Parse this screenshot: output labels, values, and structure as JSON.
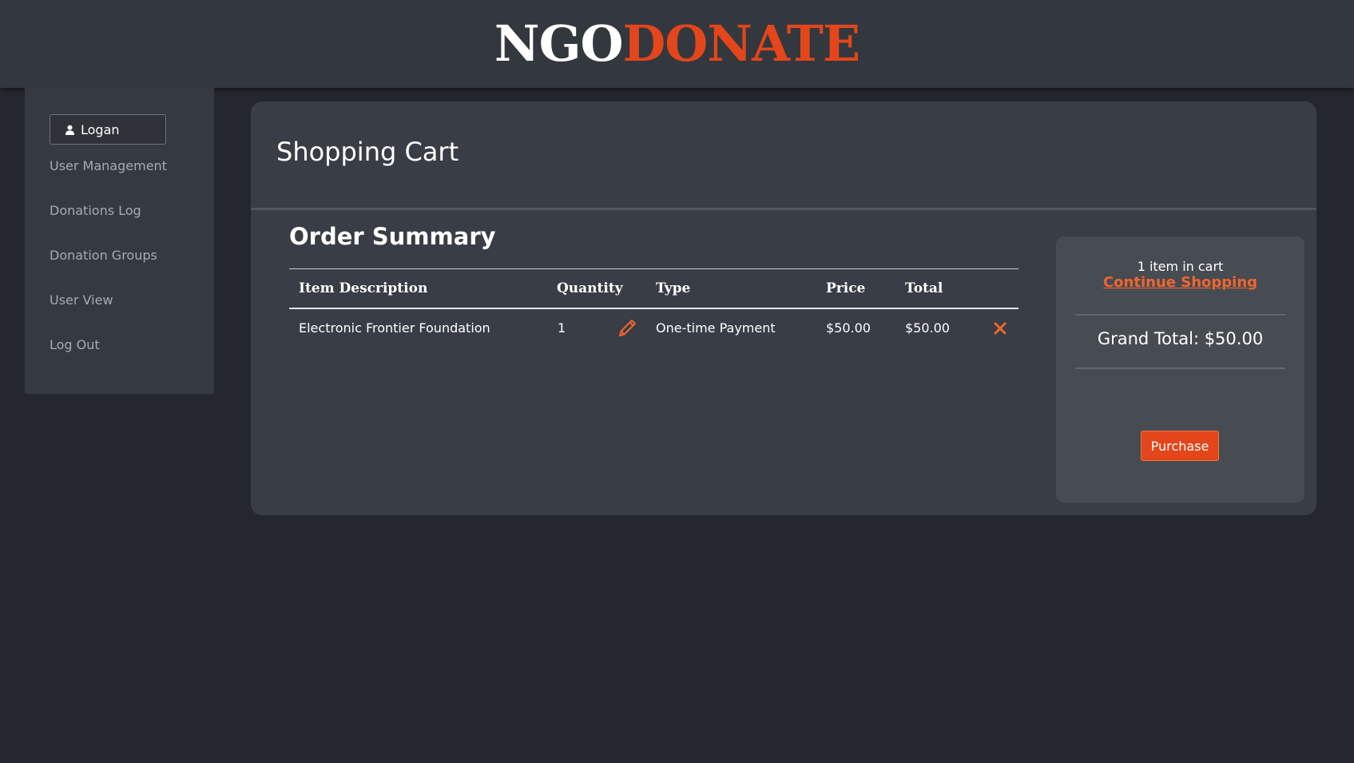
{
  "brand": {
    "part1": "NGO",
    "part2": "DONATE",
    "accent_color": "#e2461a"
  },
  "sidebar": {
    "user": {
      "icon": "user-icon",
      "name": "Logan"
    },
    "items": [
      {
        "label": "User Management"
      },
      {
        "label": "Donations Log"
      },
      {
        "label": "Donation Groups"
      },
      {
        "label": "User View"
      },
      {
        "label": "Log Out"
      }
    ]
  },
  "main": {
    "title": "Shopping Cart",
    "order_summary": {
      "title": "Order Summary",
      "columns": [
        "Item Description",
        "Quantity",
        "Type",
        "Price",
        "Total"
      ],
      "rows": [
        {
          "description": "Electronic Frontier Foundation",
          "quantity": "1",
          "type": "One-time Payment",
          "price": "$50.00",
          "total": "$50.00",
          "edit_icon": "pencil-icon",
          "remove_icon": "close-icon"
        }
      ]
    },
    "summary": {
      "items_in_cart": "1 item in cart",
      "continue_label": "Continue Shopping",
      "grand_total": "Grand Total: $50.00",
      "purchase_label": "Purchase"
    }
  }
}
